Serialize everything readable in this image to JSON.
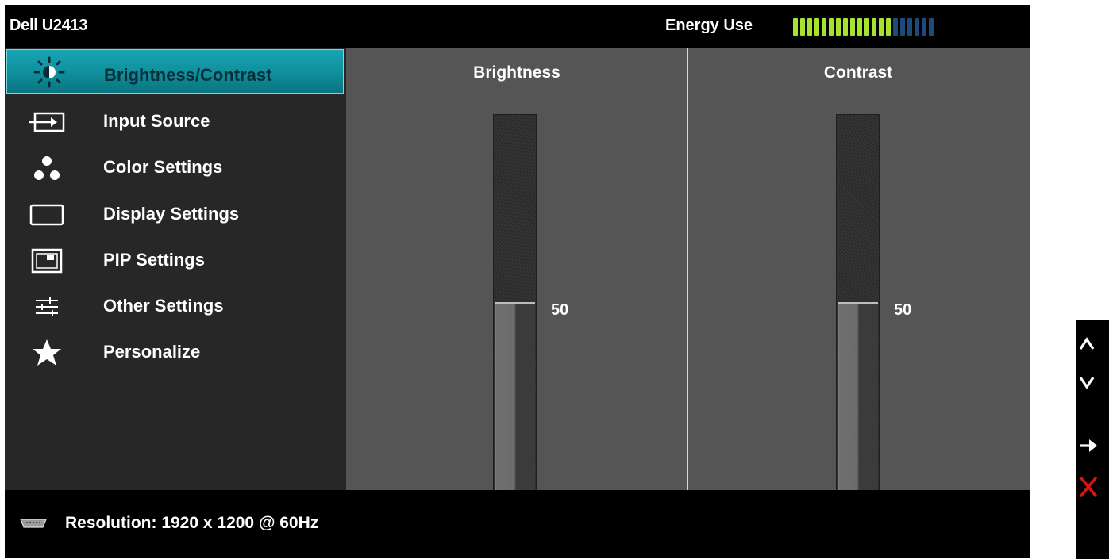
{
  "header": {
    "model": "Dell U2413",
    "energy_label": "Energy Use",
    "energy_level": {
      "active": 14,
      "total": 20
    },
    "colors": {
      "active": "#a6e22e",
      "inactive": "#1e4a7a"
    }
  },
  "menu": {
    "items": [
      {
        "label": "Brightness/Contrast",
        "icon": "brightness-icon",
        "selected": true
      },
      {
        "label": "Input Source",
        "icon": "input-source-icon",
        "selected": false
      },
      {
        "label": "Color Settings",
        "icon": "color-settings-icon",
        "selected": false
      },
      {
        "label": "Display Settings",
        "icon": "display-settings-icon",
        "selected": false
      },
      {
        "label": "PIP Settings",
        "icon": "pip-icon",
        "selected": false
      },
      {
        "label": "Other Settings",
        "icon": "other-settings-icon",
        "selected": false
      },
      {
        "label": "Personalize",
        "icon": "star-icon",
        "selected": false
      }
    ],
    "selected_color": "#12a0ae"
  },
  "brightness": {
    "title": "Brightness",
    "value": "50",
    "level_percent": 50
  },
  "contrast": {
    "title": "Contrast",
    "value": "50",
    "level_percent": 50
  },
  "status": {
    "resolution": "Resolution: 1920 x 1200 @ 60Hz",
    "icon": "connector-icon"
  },
  "nav_buttons": [
    {
      "icon": "up-icon"
    },
    {
      "icon": "down-icon"
    },
    {
      "icon": "enter-icon"
    },
    {
      "icon": "exit-icon",
      "color": "#e01010"
    }
  ]
}
